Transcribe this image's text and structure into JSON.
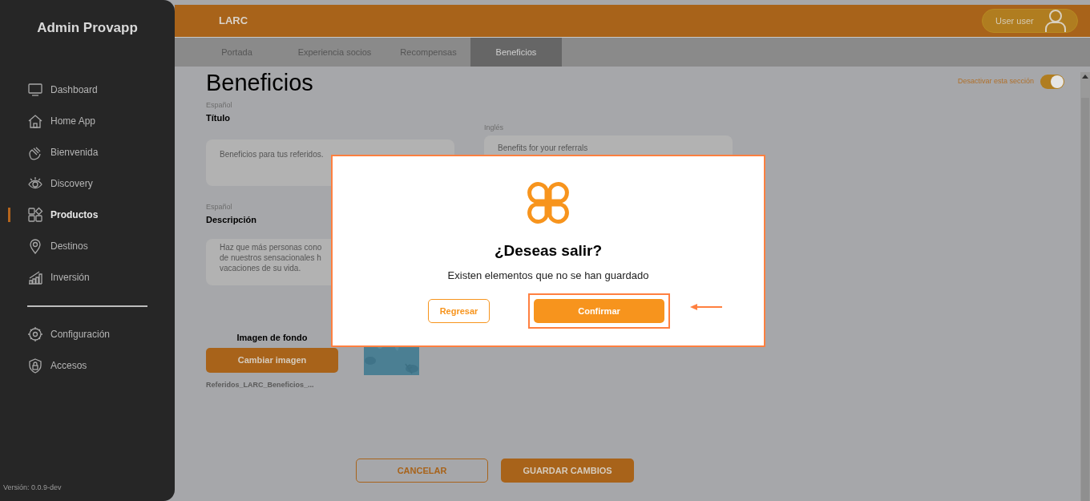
{
  "sidebar": {
    "brand": "Admin Provapp",
    "items": [
      {
        "label": "Dashboard",
        "selected": false
      },
      {
        "label": "Home App",
        "selected": false
      },
      {
        "label": "Bienvenida",
        "selected": false
      },
      {
        "label": "Discovery",
        "selected": false
      },
      {
        "label": "Productos",
        "selected": true
      },
      {
        "label": "Destinos",
        "selected": false
      },
      {
        "label": "Inversión",
        "selected": false
      }
    ],
    "settings_items": [
      {
        "label": "Configuración",
        "selected": false
      },
      {
        "label": "Accesos",
        "selected": false
      }
    ],
    "version": "Versión: 0.0.9-dev"
  },
  "header": {
    "title": "LARC",
    "user": "User user"
  },
  "tabs": [
    {
      "label": "Portada",
      "selected": false
    },
    {
      "label": "Experiencia socios",
      "selected": false
    },
    {
      "label": "Recompensas",
      "selected": false
    },
    {
      "label": "Beneficios",
      "selected": true
    }
  ],
  "page": {
    "heading": "Beneficios",
    "section_toggle": {
      "label": "Desactivar esta sección",
      "on": true
    },
    "title_field": {
      "language": "Español",
      "label": "Título",
      "value": "Beneficios para tus referidos."
    },
    "title_en_field": {
      "language": "Inglés",
      "value": "Benefits for your referrals"
    },
    "description_field": {
      "language": "Español",
      "label": "Descripción",
      "lines": [
        "Haz que más personas cono",
        "de nuestros sensacionales h",
        "vacaciones de su vida."
      ]
    },
    "background_image": {
      "label": "Imagen de fondo",
      "button": "Cambiar imagen",
      "filename": "Referidos_LARC_Beneficios_..."
    },
    "buttons": {
      "cancel": "CANCELAR",
      "save": "GUARDAR CAMBIOS"
    }
  },
  "dialog": {
    "title": "¿Deseas salir?",
    "message": "Existen elementos que no se han guardado",
    "back": "Regresar",
    "confirm": "Confirmar",
    "confirm_highlighted": true
  }
}
